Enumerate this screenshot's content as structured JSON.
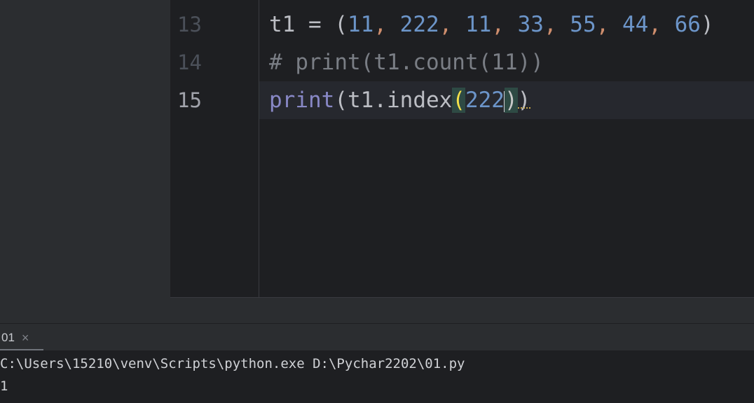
{
  "editor": {
    "gutter": [
      "13",
      "14",
      "15"
    ],
    "lines": {
      "l13": {
        "var": "t1",
        "assign": " = ",
        "open": "(",
        "nums": [
          "11",
          "222",
          "11",
          "33",
          "55",
          "44",
          "66"
        ],
        "comma": ", ",
        "close": ")"
      },
      "l14": {
        "comment": "# print(t1.count(11))"
      },
      "l15": {
        "builtin": "print",
        "open": "(",
        "obj": "t1.index",
        "inner_open": "(",
        "arg": "222",
        "inner_close": ")",
        "close": ")"
      }
    }
  },
  "run_panel": {
    "tab_label": "01",
    "close_glyph": "×",
    "console": [
      "C:\\Users\\15210\\venv\\Scripts\\python.exe D:\\Pychar2202\\01.py",
      "1"
    ]
  },
  "colors": {
    "number": "#6c95c9",
    "comma": "#cf8e6d",
    "comment": "#7a7e85",
    "builtin": "#8888c6",
    "paren_highlight": "#f5e14a",
    "editor_bg": "#1e1f22",
    "panel_bg": "#2b2d30"
  }
}
